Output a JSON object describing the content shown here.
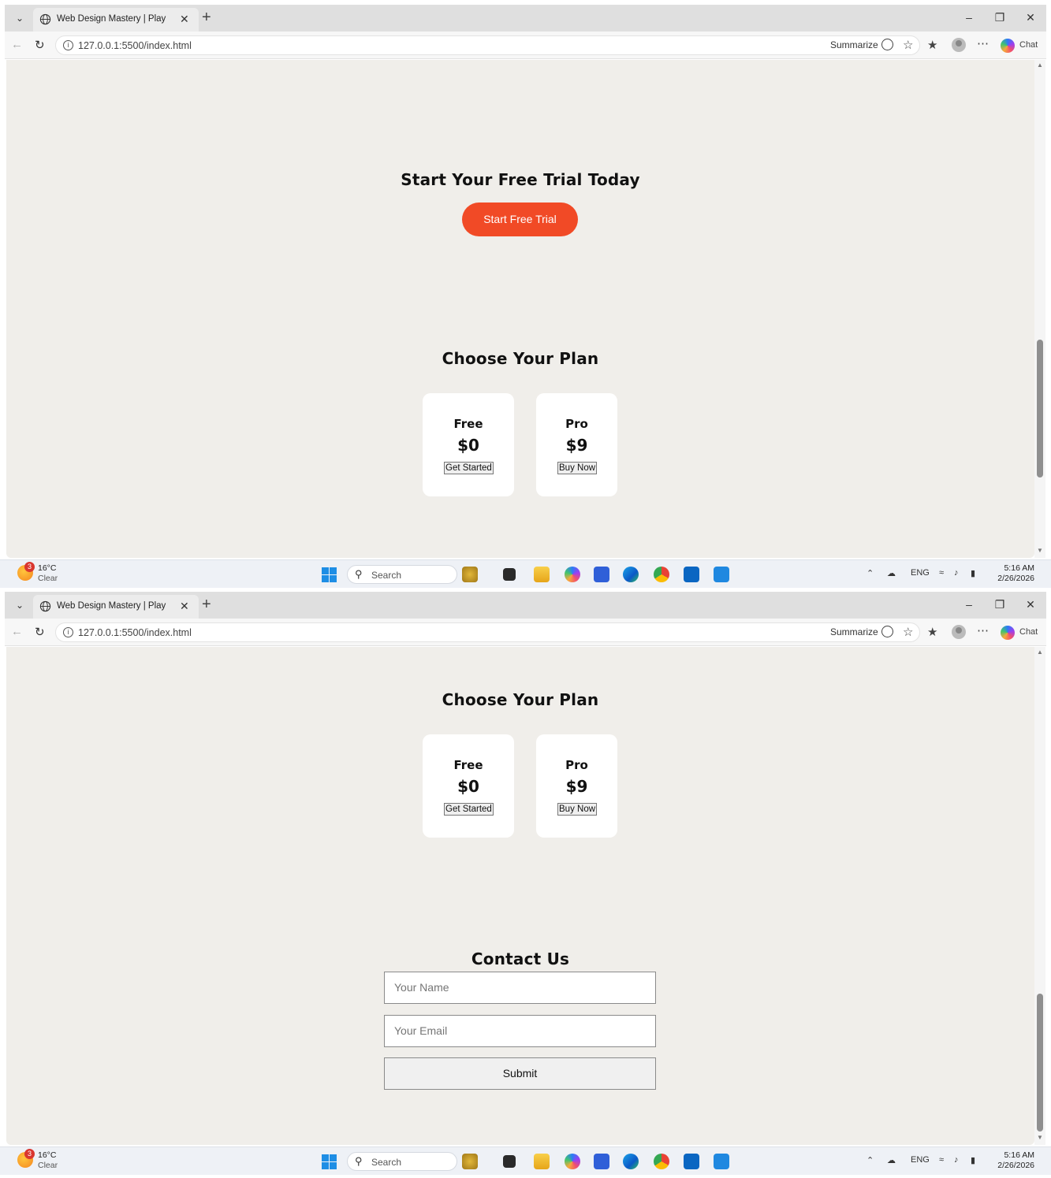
{
  "browser": {
    "tab_title": "Web Design Mastery | Play",
    "url": "127.0.0.1:5500/index.html",
    "summarize_label": "Summarize",
    "chat_label": "Chat",
    "icons": [
      "tab-list-icon",
      "globe-icon",
      "close-icon",
      "new-tab-icon",
      "minimize-icon",
      "restore-icon",
      "window-close-icon",
      "back-icon",
      "reload-icon",
      "info-icon",
      "summarize-icon",
      "favorite-star-icon",
      "favorites-list-icon",
      "profile-icon",
      "more-icon",
      "copilot-icon"
    ]
  },
  "screen1": {
    "trial": {
      "heading": "Start Your Free Trial Today",
      "button_label": "Start Free Trial"
    },
    "plans": {
      "heading": "Choose Your Plan",
      "items": [
        {
          "name": "Free",
          "price": "$0",
          "button": "Get Started"
        },
        {
          "name": "Pro",
          "price": "$9",
          "button": "Buy Now"
        }
      ]
    }
  },
  "screen2": {
    "plans": {
      "heading": "Choose Your Plan",
      "items": [
        {
          "name": "Free",
          "price": "$0",
          "button": "Get Started"
        },
        {
          "name": "Pro",
          "price": "$9",
          "button": "Buy Now"
        }
      ]
    },
    "contact": {
      "heading": "Contact Us",
      "name_placeholder": "Your Name",
      "email_placeholder": "Your Email",
      "submit_label": "Submit"
    }
  },
  "taskbar": {
    "weather_badge": "3",
    "temperature": "16°C",
    "condition": "Clear",
    "search_label": "Search",
    "language": "ENG",
    "time": "5:16 AM",
    "date": "2/26/2026",
    "apps": [
      "windows-start-icon",
      "search-icon",
      "widgets-icon",
      "terminal-icon",
      "file-explorer-icon",
      "copilot-app-icon",
      "powerapps-icon",
      "edge-icon",
      "chrome-icon",
      "linkedin-icon",
      "vscode-icon"
    ]
  },
  "colors": {
    "page_bg": "#f0eeea",
    "accent": "#f14a26",
    "card_bg": "#ffffff"
  }
}
